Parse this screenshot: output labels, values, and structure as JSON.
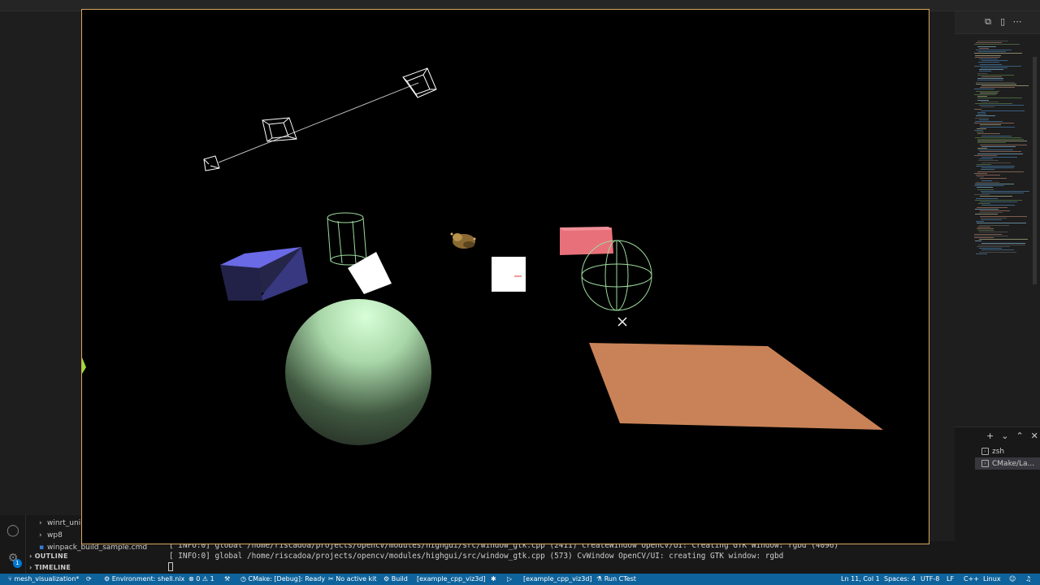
{
  "explorer": {
    "items": [
      "winrt_uni",
      "wp8",
      "winpack_build_sample.cmd"
    ],
    "outline": "OUTLINE",
    "timeline": "TIMELINE",
    "badge": "1"
  },
  "terminal": {
    "lines": [
      "[ INFO:0] global /home/riscadoa/projects/opencv/modules/highgui/src/window_gtk.cpp (2411) createWindow OpenCV/UI: Creating GTK Window: rgbd (4096)",
      "[ INFO:0] global /home/riscadoa/projects/opencv/modules/highgui/src/window_gtk.cpp (573) CvWindow OpenCV/UI: creating GTK window: rgbd"
    ],
    "sessions": [
      "zsh",
      "CMake/La..."
    ]
  },
  "statusbar": {
    "branch": "mesh_visualization*",
    "environment": "Environment: shell.nix",
    "errors": "0",
    "warnings": "1",
    "cmake": "CMake: [Debug]: Ready",
    "kit": "No active kit",
    "build": "Build",
    "target": "[example_cpp_viz3d]",
    "launch_target": "[example_cpp_viz3d]",
    "ctest": "Run CTest",
    "position": "Ln 11, Col 1",
    "spaces": "Spaces: 4",
    "encoding": "UTF-8",
    "eol": "LF",
    "language": "C++",
    "platform": "Linux"
  },
  "viz": {
    "border_color": "#d9a960",
    "colors": {
      "box": "#6f6fe8",
      "plane": "#c98257",
      "pink_box": "#e8707a",
      "sphere": "#c8f0c8",
      "wire": "#9ddc9d"
    }
  }
}
